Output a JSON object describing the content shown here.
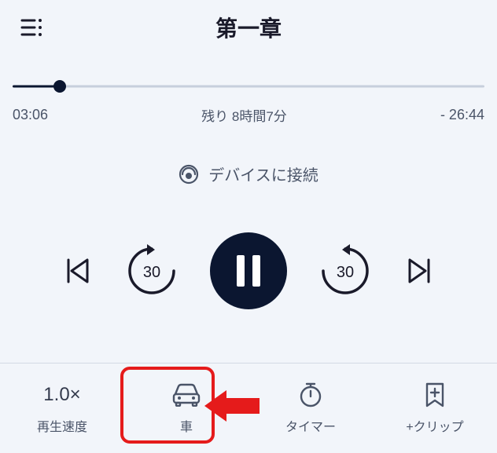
{
  "header": {
    "title": "第一章"
  },
  "progress": {
    "elapsed": "03:06",
    "remaining_label": "残り 8時間7分",
    "remaining_time": "- 26:44",
    "percent": 10
  },
  "device": {
    "label": "デバイスに接続"
  },
  "controls": {
    "back_seconds": "30",
    "forward_seconds": "30"
  },
  "bottom": {
    "speed": {
      "value": "1.0×",
      "label": "再生速度"
    },
    "car": {
      "label": "車"
    },
    "timer": {
      "label": "タイマー"
    },
    "clip": {
      "label": "+クリップ"
    }
  }
}
